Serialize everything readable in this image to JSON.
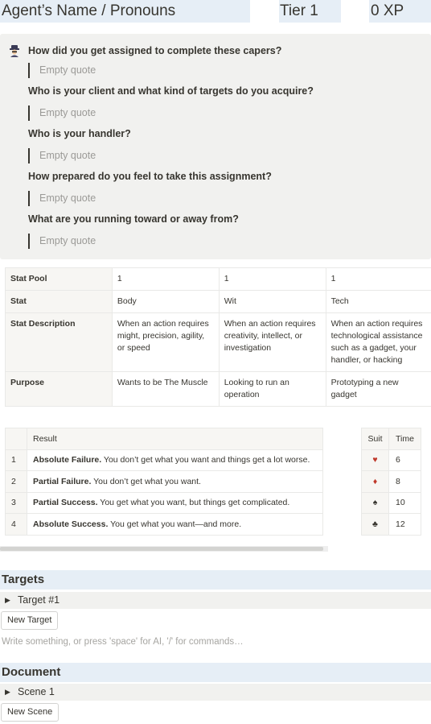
{
  "header": {
    "agent_name": "Agent’s Name / Pronouns",
    "tier": "Tier 1",
    "xp": "0 XP"
  },
  "callout": {
    "icon": "spy-icon",
    "questions": [
      {
        "q": "How did you get assigned to complete these capers?",
        "answer_placeholder": "Empty quote"
      },
      {
        "q": "Who is your client and what kind of targets do you acquire?",
        "answer_placeholder": "Empty quote"
      },
      {
        "q": "Who is your handler?",
        "answer_placeholder": "Empty quote"
      },
      {
        "q": "How prepared do you feel to take this assignment?",
        "answer_placeholder": "Empty quote"
      },
      {
        "q": "What are you running toward or away from?",
        "answer_placeholder": "Empty quote"
      }
    ]
  },
  "stats_table": {
    "rows": [
      {
        "header": "Stat Pool",
        "cells": [
          "1",
          "1",
          "1"
        ]
      },
      {
        "header": "Stat",
        "cells": [
          "Body",
          "Wit",
          "Tech"
        ]
      },
      {
        "header": "Stat Description",
        "cells": [
          "When an action requires might, precision, agility, or speed",
          "When an action requires creativity, intellect, or investigation",
          "When an action requires technological assistance such as a gadget, your handler, or hacking"
        ]
      },
      {
        "header": "Purpose",
        "cells": [
          "Wants to be The Muscle",
          "Looking to run an operation",
          "Prototyping a new gadget"
        ]
      }
    ]
  },
  "results_table": {
    "header": "Result",
    "rows": [
      {
        "num": "1",
        "bold": "Absolute Failure.",
        "text": " You don’t get what you want and things get a lot worse."
      },
      {
        "num": "2",
        "bold": "Partial Failure.",
        "text": " You don’t get what you want."
      },
      {
        "num": "3",
        "bold": "Partial Success.",
        "text": " You get what you want, but things get complicated."
      },
      {
        "num": "4",
        "bold": "Absolute Success.",
        "text": " You get what you want—and more."
      }
    ]
  },
  "suit_table": {
    "headers": [
      "Suit",
      "Time"
    ],
    "rows": [
      {
        "suit": "♥",
        "suit_name": "heart-icon",
        "color": "#c0392b",
        "time": "6"
      },
      {
        "suit": "♦",
        "suit_name": "diamond-icon",
        "color": "#c0392b",
        "time": "8"
      },
      {
        "suit": "♠",
        "suit_name": "spade-icon",
        "color": "#37352f",
        "time": "10"
      },
      {
        "suit": "♣",
        "suit_name": "club-icon",
        "color": "#37352f",
        "time": "12"
      }
    ]
  },
  "targets": {
    "heading": "Targets",
    "toggle_label": "Target #1",
    "new_button": "New Target"
  },
  "editor": {
    "placeholder": "Write something, or press 'space' for AI, '/' for commands…"
  },
  "document": {
    "heading": "Document",
    "toggle_label": "Scene 1",
    "new_button": "New Scene"
  },
  "colors": {
    "header_bg": "#e6eef6",
    "callout_bg": "#f1f1ef",
    "text": "#37352f",
    "muted": "#9b9a97"
  }
}
